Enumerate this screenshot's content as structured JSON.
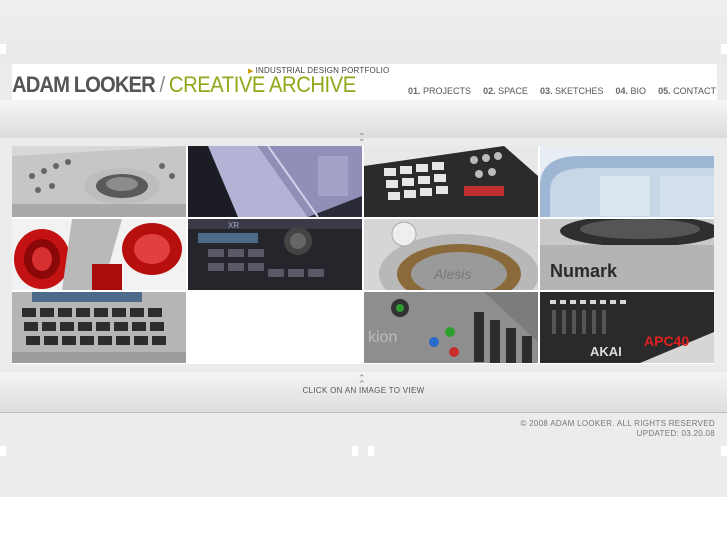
{
  "header": {
    "subtitle": "INDUSTRIAL DESIGN PORTFOLIO",
    "name": "ADAM LOOKER",
    "slash": " / ",
    "title": "CREATIVE ARCHIVE"
  },
  "nav": [
    {
      "num": "01.",
      "label": "PROJECTS"
    },
    {
      "num": "02.",
      "label": "SPACE"
    },
    {
      "num": "03.",
      "label": "SKETCHES"
    },
    {
      "num": "04.",
      "label": "BIO"
    },
    {
      "num": "05.",
      "label": "CONTACT"
    }
  ],
  "gallery": {
    "hint": "CLICK ON AN IMAGE TO VIEW",
    "thumbnails": [
      {
        "subject": "dj-mixer-controller"
      },
      {
        "subject": "purple-panel-design"
      },
      {
        "subject": "akai-mpd-pad-controller"
      },
      {
        "subject": "light-blue-enclosure"
      },
      {
        "subject": "red-knob-closeup"
      },
      {
        "subject": "akai-xr20-drum-machine"
      },
      {
        "subject": "alesis-turntable-detail"
      },
      {
        "subject": "numark-turntable"
      },
      {
        "subject": "keypad-device"
      },
      {
        "subject": "empty"
      },
      {
        "subject": "alesis-ion-synth"
      },
      {
        "subject": "akai-apc40-controller"
      }
    ],
    "labels": {
      "xr": "XR",
      "numark": "Numark",
      "akai": "AKAI",
      "apc": "APC40",
      "ion": "kion",
      "alesis": "Alesis"
    }
  },
  "footer": {
    "copyright": "© 2008 ADAM LOOKER. ALL RIGHTS RESERVED",
    "updated": "UPDATED: 03.20.08"
  },
  "colors": {
    "accent": "#8fa818",
    "header_bg": "#ffffff",
    "band": "#ececec"
  }
}
